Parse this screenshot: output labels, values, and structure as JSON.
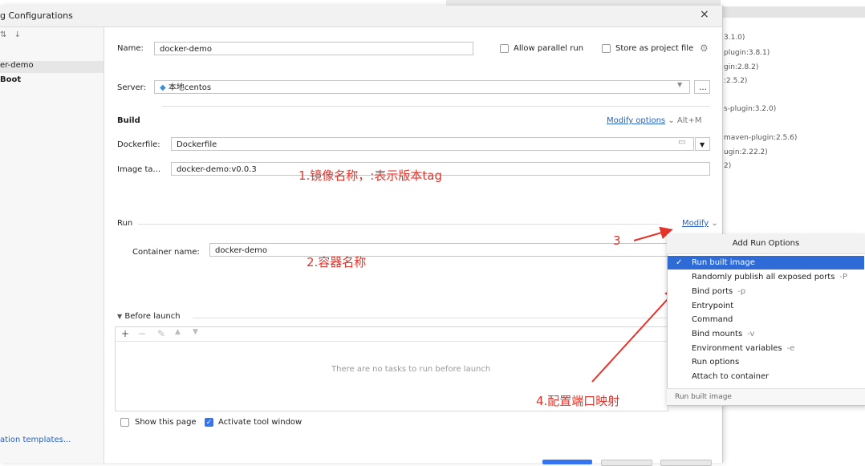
{
  "dialog": {
    "title": "g Configurations",
    "close": "×"
  },
  "tree": {
    "items": [
      "er-demo",
      "Boot"
    ],
    "edit_templates": "ation templates..."
  },
  "form": {
    "name_label": "Name:",
    "name_value": "docker-demo",
    "allow_parallel": "Allow parallel run",
    "store_project": "Store as project file",
    "server_label": "Server:",
    "server_value": "本地centos",
    "build_heading": "Build",
    "modify_options": "Modify options",
    "modify_shortcut": "Alt+M",
    "dockerfile_label": "Dockerfile:",
    "dockerfile_value": "Dockerfile",
    "image_tag_label": "Image ta...",
    "image_tag_value": "docker-demo:v0.0.3",
    "run_heading": "Run",
    "modify_link": "Modify",
    "container_label": "Container name:",
    "container_value": "docker-demo",
    "before_launch": "Before launch",
    "no_tasks": "There are no tasks to run before launch",
    "show_page": "Show this page",
    "activate_tool": "Activate tool window"
  },
  "annotations": {
    "a1": "1.镜像名称，:表示版本tag",
    "a2": "2.容器名称",
    "a3": "3",
    "a4": "4.配置端口映射",
    "color": "#e5332a"
  },
  "menu": {
    "header": "Add Run Options",
    "items": [
      {
        "label": "Run built image",
        "shortcut": "",
        "selected": true
      },
      {
        "label": "Randomly publish all exposed ports",
        "shortcut": "-P"
      },
      {
        "label": "Bind ports",
        "shortcut": "-p"
      },
      {
        "label": "Entrypoint",
        "shortcut": ""
      },
      {
        "label": "Command",
        "shortcut": ""
      },
      {
        "label": "Bind mounts",
        "shortcut": "-v"
      },
      {
        "label": "Environment variables",
        "shortcut": "-e"
      },
      {
        "label": "Run options",
        "shortcut": ""
      },
      {
        "label": "Attach to container",
        "shortcut": ""
      }
    ],
    "footer": "Run built image"
  },
  "background_list": [
    "3.1.0)",
    "plugin:3.8.1)",
    "gin:2.8.2)",
    ":2.5.2)",
    "s-plugin:3.2.0)",
    "maven-plugin:2.5.6)",
    "ugin:2.22.2)",
    "2)"
  ]
}
